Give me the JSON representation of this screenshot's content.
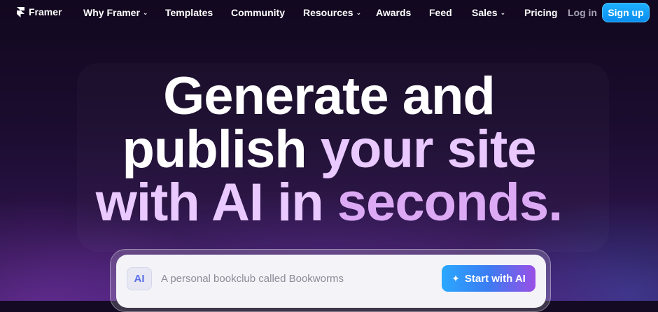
{
  "nav": {
    "brand": "Framer",
    "items": [
      {
        "label": "Why Framer",
        "dropdown": true
      },
      {
        "label": "Templates",
        "dropdown": false
      },
      {
        "label": "Community",
        "dropdown": false
      },
      {
        "label": "Resources",
        "dropdown": true
      },
      {
        "label": "Awards",
        "dropdown": false
      },
      {
        "label": "Feed",
        "dropdown": false
      },
      {
        "label": "Sales",
        "dropdown": true
      },
      {
        "label": "Pricing",
        "dropdown": false
      }
    ],
    "login": "Log in",
    "signup": "Sign up"
  },
  "hero": {
    "line1": "Generate and",
    "line2_a": "publish ",
    "line2_b": "your site",
    "line3_a": "with ",
    "line3_b": "AI in ",
    "line3_c": "seconds."
  },
  "prompt": {
    "badge": "AI",
    "placeholder": "A personal bookclub called Bookworms",
    "button": "Start with AI"
  },
  "colors": {
    "accent_blue": "#0a8ef0",
    "headline_white": "#ffffff",
    "headline_lilac": "#e9c9ff"
  }
}
